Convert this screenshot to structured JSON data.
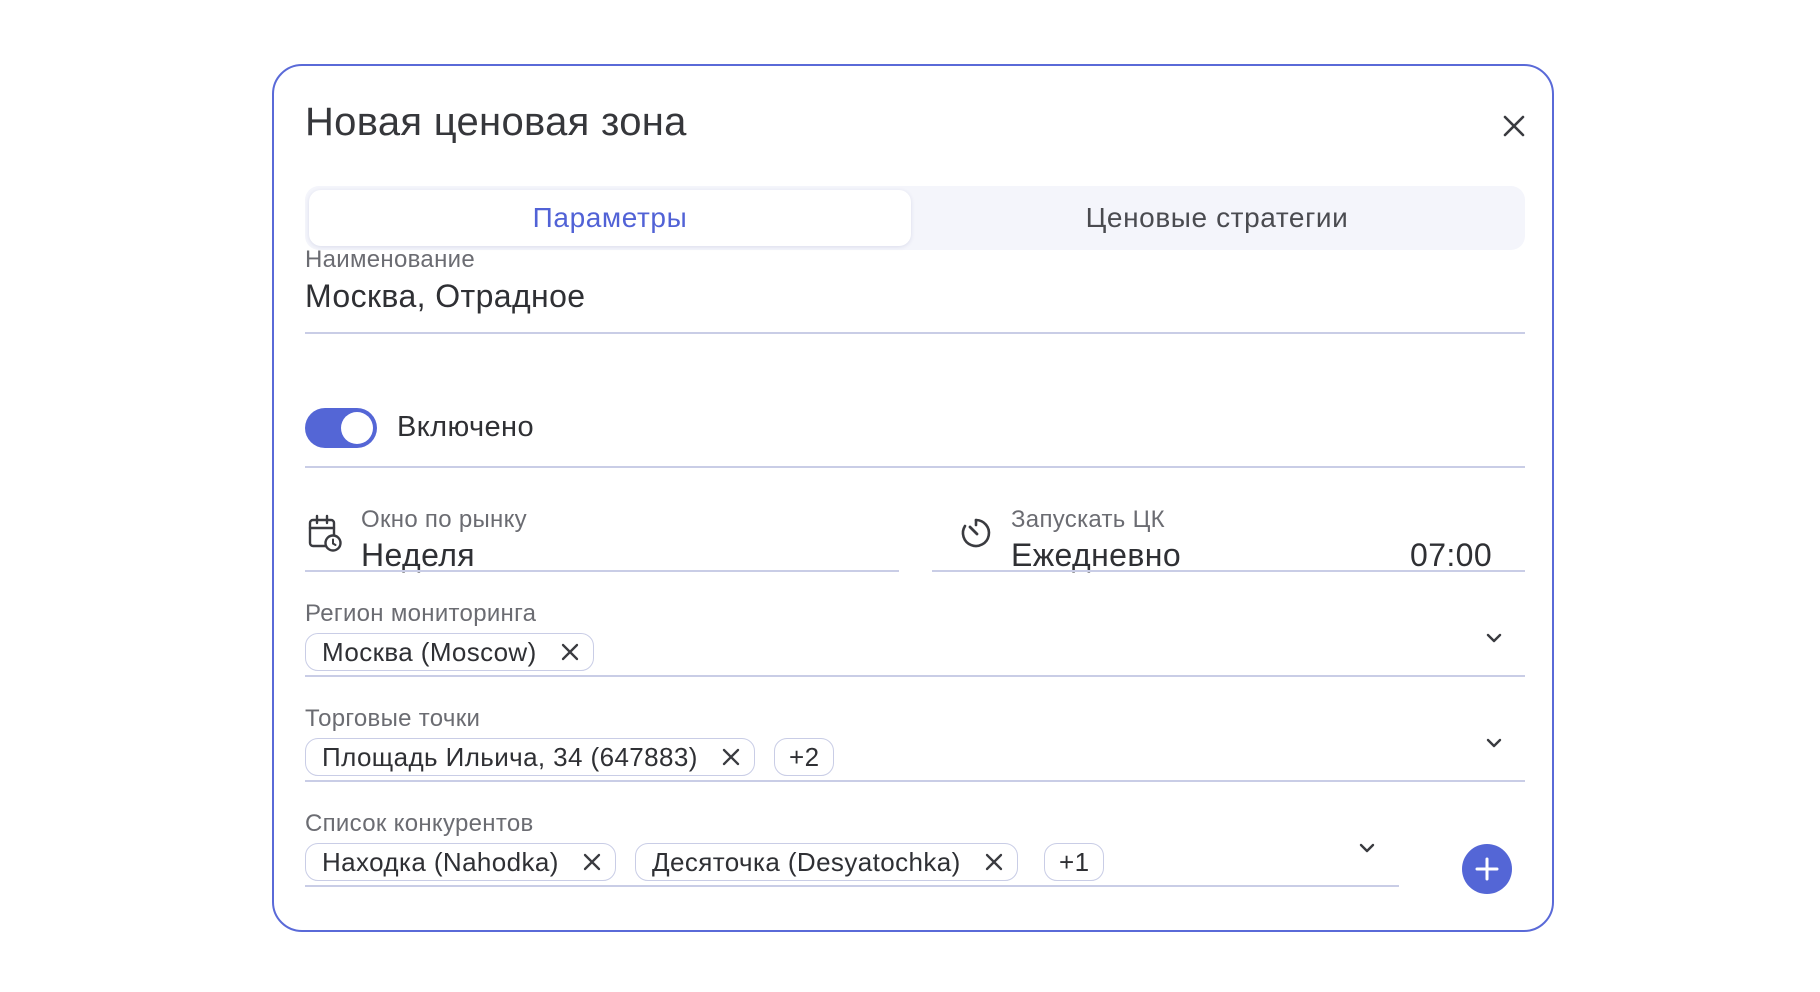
{
  "dialog": {
    "title": "Новая ценовая зона",
    "tabs": [
      {
        "label": "Параметры",
        "active": true
      },
      {
        "label": "Ценовые стратегии",
        "active": false
      }
    ]
  },
  "name_field": {
    "label": "Наименование",
    "value": "Москва, Отрадное"
  },
  "enabled_toggle": {
    "label": "Включено",
    "on": true
  },
  "market_window": {
    "label": "Окно по рынку",
    "value": "Неделя",
    "icon": "calendar-clock-icon"
  },
  "run_schedule": {
    "label": "Запускать ЦК",
    "value": "Ежедневно",
    "time": "07:00",
    "icon": "timer-icon"
  },
  "monitoring_region": {
    "label": "Регион мониторинга",
    "chips": [
      "Москва (Moscow)"
    ]
  },
  "stores": {
    "label": "Торговые точки",
    "chips": [
      "Площадь Ильича, 34 (647883)"
    ],
    "more": "+2"
  },
  "competitors": {
    "label": "Список конкурентов",
    "chips": [
      "Находка (Nahodka)",
      "Десяточка (Desyatochka)"
    ],
    "more": "+1"
  },
  "colors": {
    "accent": "#5466d6",
    "border": "#5a6ad8",
    "underline": "#c9cde6"
  }
}
